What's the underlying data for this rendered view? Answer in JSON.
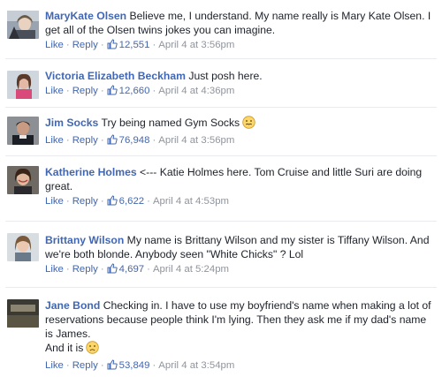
{
  "actions": {
    "like": "Like",
    "reply": "Reply",
    "separator": "·"
  },
  "colors": {
    "author": "#4267b2",
    "text": "#1d2129",
    "meta": "#90949c"
  },
  "comments": [
    {
      "author": "MaryKate Olsen",
      "text": "Believe me, I understand. My name really is Mary Kate Olsen. I get all of the Olsen twins jokes you can imagine.",
      "likes": "12,551",
      "time": "April 4 at 3:56pm"
    },
    {
      "author": "Victoria Elizabeth Beckham",
      "text": "Just posh here.",
      "likes": "12,660",
      "time": "April 4 at 4:36pm"
    },
    {
      "author": "Jim Socks",
      "text": "Try being named Gym Socks",
      "emoji": "grimace-emoji",
      "likes": "76,948",
      "time": "April 4 at 3:56pm"
    },
    {
      "author": "Katherine Holmes",
      "text": "<--- Katie Holmes here. Tom Cruise and little Suri are doing great.",
      "likes": "6,622",
      "time": "April 4 at 4:53pm"
    },
    {
      "author": "Brittany Wilson",
      "text": "My name is Brittany Wilson and my sister is Tiffany Wilson. And we're both blonde. Anybody seen \"White Chicks\" ? Lol",
      "likes": "4,697",
      "time": "April 4 at 5:24pm"
    },
    {
      "author": "Jane Bond",
      "text": "Checking in. I have to use my boyfriend's name when making a lot of reservations because people think I'm lying. Then they ask me if my dad's name is James.",
      "text_line2": "And it is",
      "emoji": "frown-emoji",
      "likes": "53,849",
      "time": "April 4 at 3:54pm"
    }
  ]
}
